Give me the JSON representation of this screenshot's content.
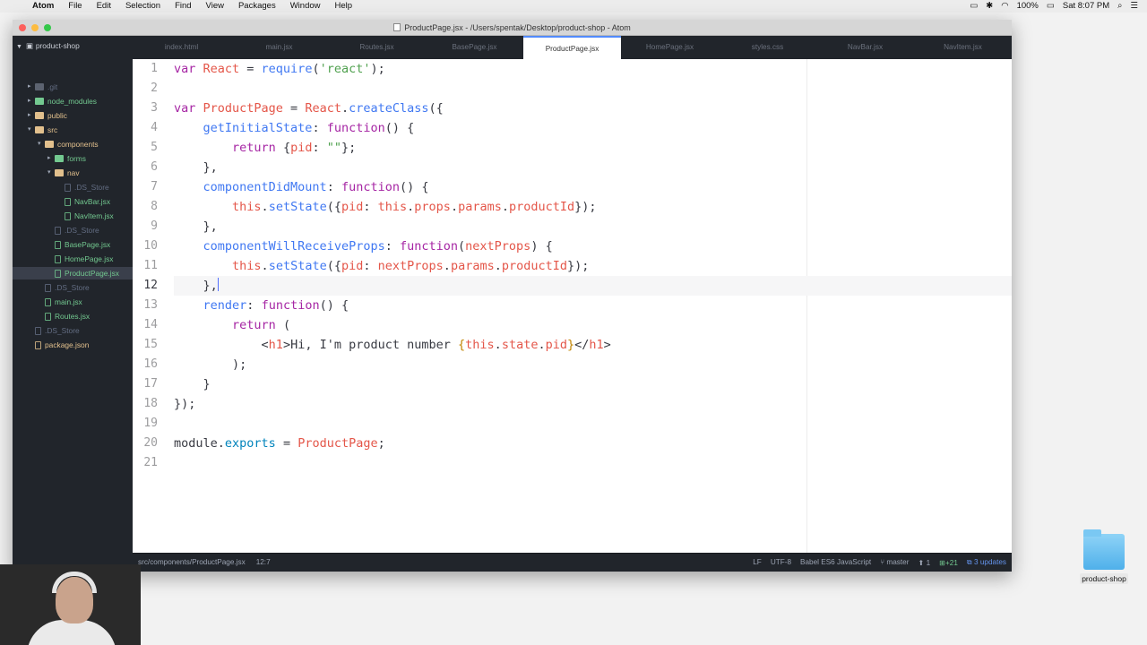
{
  "menubar": {
    "app": "Atom",
    "items": [
      "File",
      "Edit",
      "Selection",
      "Find",
      "View",
      "Packages",
      "Window",
      "Help"
    ],
    "battery": "100%",
    "clock": "Sat 8:07 PM"
  },
  "window": {
    "title": "ProductPage.jsx - /Users/spentak/Desktop/product-shop - Atom"
  },
  "tree": {
    "project": "product-shop",
    "rows": [
      {
        "label": ".git",
        "kind": "folder",
        "depth": 1
      },
      {
        "label": "node_modules",
        "kind": "folder",
        "depth": 1
      },
      {
        "label": "public",
        "kind": "folder",
        "depth": 1
      },
      {
        "label": "src",
        "kind": "folder-open",
        "depth": 1
      },
      {
        "label": "components",
        "kind": "folder-open",
        "depth": 2
      },
      {
        "label": "forms",
        "kind": "folder",
        "depth": 3
      },
      {
        "label": "nav",
        "kind": "folder-open",
        "depth": 3
      },
      {
        "label": ".DS_Store",
        "kind": "file-dim",
        "depth": 4
      },
      {
        "label": "NavBar.jsx",
        "kind": "file",
        "depth": 4
      },
      {
        "label": "NavItem.jsx",
        "kind": "file",
        "depth": 4
      },
      {
        "label": ".DS_Store",
        "kind": "file-dim",
        "depth": 3
      },
      {
        "label": "BasePage.jsx",
        "kind": "file",
        "depth": 3
      },
      {
        "label": "HomePage.jsx",
        "kind": "file",
        "depth": 3
      },
      {
        "label": "ProductPage.jsx",
        "kind": "file-selected",
        "depth": 3
      },
      {
        "label": ".DS_Store",
        "kind": "file-dim",
        "depth": 2
      },
      {
        "label": "main.jsx",
        "kind": "file",
        "depth": 2
      },
      {
        "label": "Routes.jsx",
        "kind": "file",
        "depth": 2
      },
      {
        "label": ".DS_Store",
        "kind": "file-dim",
        "depth": 1
      },
      {
        "label": "package.json",
        "kind": "file",
        "depth": 1
      }
    ]
  },
  "tabs": [
    "index.html",
    "main.jsx",
    "Routes.jsx",
    "BasePage.jsx",
    "ProductPage.jsx",
    "HomePage.jsx",
    "styles.css",
    "NavBar.jsx",
    "NavItem.jsx"
  ],
  "active_tab": "ProductPage.jsx",
  "code_lines": [
    [
      [
        "k",
        "var "
      ],
      [
        "v",
        "React"
      ],
      [
        "p",
        " = "
      ],
      [
        "f",
        "require"
      ],
      [
        "p",
        "("
      ],
      [
        "s",
        "'react'"
      ],
      [
        "p",
        ");"
      ]
    ],
    [],
    [
      [
        "k",
        "var "
      ],
      [
        "v",
        "ProductPage"
      ],
      [
        "p",
        " = "
      ],
      [
        "v",
        "React"
      ],
      [
        "p",
        "."
      ],
      [
        "f",
        "createClass"
      ],
      [
        "p",
        "({"
      ]
    ],
    [
      [
        "p",
        "    "
      ],
      [
        "f",
        "getInitialState"
      ],
      [
        "p",
        ": "
      ],
      [
        "k",
        "function"
      ],
      [
        "p",
        "() {"
      ]
    ],
    [
      [
        "p",
        "        "
      ],
      [
        "k",
        "return"
      ],
      [
        "p",
        " {"
      ],
      [
        "v",
        "pid"
      ],
      [
        "p",
        ": "
      ],
      [
        "s",
        "\"\""
      ],
      [
        "p",
        "};"
      ]
    ],
    [
      [
        "p",
        "    },"
      ]
    ],
    [
      [
        "p",
        "    "
      ],
      [
        "f",
        "componentDidMount"
      ],
      [
        "p",
        ": "
      ],
      [
        "k",
        "function"
      ],
      [
        "p",
        "() {"
      ]
    ],
    [
      [
        "p",
        "        "
      ],
      [
        "v",
        "this"
      ],
      [
        "p",
        "."
      ],
      [
        "f",
        "setState"
      ],
      [
        "p",
        "({"
      ],
      [
        "v",
        "pid"
      ],
      [
        "p",
        ": "
      ],
      [
        "v",
        "this"
      ],
      [
        "p",
        "."
      ],
      [
        "v",
        "props"
      ],
      [
        "p",
        "."
      ],
      [
        "v",
        "params"
      ],
      [
        "p",
        "."
      ],
      [
        "v",
        "productId"
      ],
      [
        "p",
        "});"
      ]
    ],
    [
      [
        "p",
        "    },"
      ]
    ],
    [
      [
        "p",
        "    "
      ],
      [
        "f",
        "componentWillReceiveProps"
      ],
      [
        "p",
        ": "
      ],
      [
        "k",
        "function"
      ],
      [
        "p",
        "("
      ],
      [
        "v",
        "nextProps"
      ],
      [
        "p",
        ") {"
      ]
    ],
    [
      [
        "p",
        "        "
      ],
      [
        "v",
        "this"
      ],
      [
        "p",
        "."
      ],
      [
        "f",
        "setState"
      ],
      [
        "p",
        "({"
      ],
      [
        "v",
        "pid"
      ],
      [
        "p",
        ": "
      ],
      [
        "v",
        "nextProps"
      ],
      [
        "p",
        "."
      ],
      [
        "v",
        "params"
      ],
      [
        "p",
        "."
      ],
      [
        "v",
        "productId"
      ],
      [
        "p",
        "});"
      ]
    ],
    [
      [
        "p",
        "    },"
      ]
    ],
    [
      [
        "p",
        "    "
      ],
      [
        "f",
        "render"
      ],
      [
        "p",
        ": "
      ],
      [
        "k",
        "function"
      ],
      [
        "p",
        "() {"
      ]
    ],
    [
      [
        "p",
        "        "
      ],
      [
        "k",
        "return"
      ],
      [
        "p",
        " ("
      ]
    ],
    [
      [
        "p",
        "            <"
      ],
      [
        "v",
        "h1"
      ],
      [
        "p",
        ">Hi, I'm product number "
      ],
      [
        "t",
        "{"
      ],
      [
        "v",
        "this"
      ],
      [
        "p",
        "."
      ],
      [
        "v",
        "state"
      ],
      [
        "p",
        "."
      ],
      [
        "v",
        "pid"
      ],
      [
        "t",
        "}"
      ],
      [
        "p",
        "</"
      ],
      [
        "v",
        "h1"
      ],
      [
        "p",
        ">"
      ]
    ],
    [
      [
        "p",
        "        );"
      ]
    ],
    [
      [
        "p",
        "    }"
      ]
    ],
    [
      [
        "p",
        "});"
      ]
    ],
    [],
    [
      [
        "p",
        "module."
      ],
      [
        "o",
        "exports"
      ],
      [
        "p",
        " = "
      ],
      [
        "v",
        "ProductPage"
      ],
      [
        "p",
        ";"
      ]
    ],
    []
  ],
  "current_line": 12,
  "status": {
    "path": "src/components/ProductPage.jsx",
    "position": "12:7",
    "line_ending": "LF",
    "encoding": "UTF-8",
    "grammar": "Babel ES6 JavaScript",
    "branch": "master",
    "ahead": "1",
    "diff": "+21",
    "updates": "3 updates"
  },
  "desktop_icon": {
    "label": "product-shop"
  }
}
